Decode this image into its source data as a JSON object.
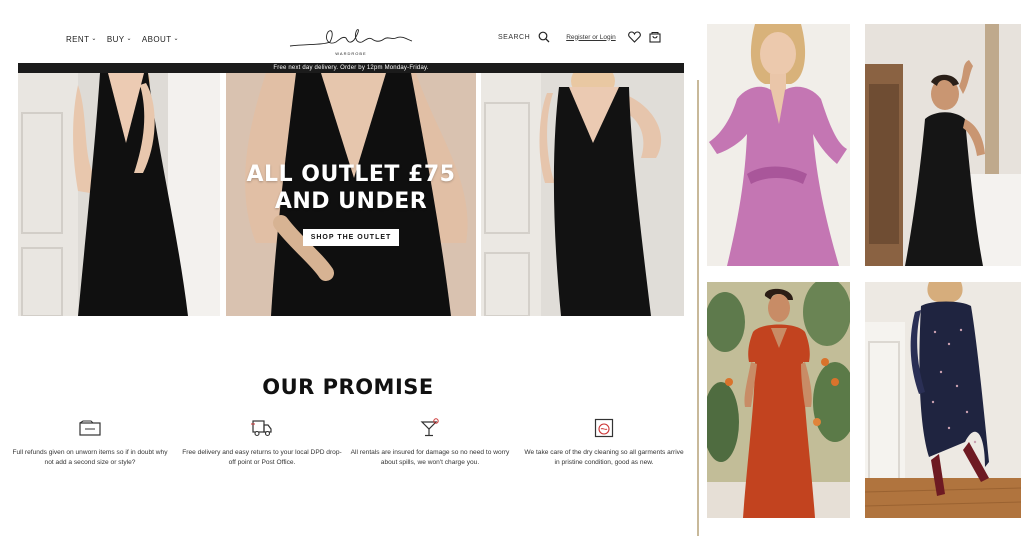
{
  "header": {
    "nav": [
      {
        "label": "RENT"
      },
      {
        "label": "BUY"
      },
      {
        "label": "ABOUT"
      }
    ],
    "logo_script": "Endless",
    "logo_sub": "WARDROBE",
    "search_label": "SEARCH",
    "login_label": "Register or Login"
  },
  "announcement": "Free next day delivery. Order by 12pm Monday-Friday.",
  "hero": {
    "title_line1": "ALL OUTLET £75",
    "title_line2": "AND UNDER",
    "cta": "SHOP THE OUTLET"
  },
  "promise": {
    "title": "OUR PROMISE",
    "items": [
      {
        "icon": "wardrobe-icon",
        "text": "Full refunds given on unworn items so if in doubt why not add a second size or style?"
      },
      {
        "icon": "delivery-truck-icon",
        "text": "Free delivery and easy returns to your local DPD drop-off point or Post Office."
      },
      {
        "icon": "cocktail-glass-icon",
        "text": "All rentals are insured for damage so no need to worry about spills, we won't charge you."
      },
      {
        "icon": "washing-machine-icon",
        "text": "We take care of the dry cleaning so all garments arrive in pristine condition, good as new."
      }
    ]
  },
  "colors": {
    "announcement_bg": "#1b1b1b",
    "divider": "#c8b99a",
    "pink_dress": "#c476b3",
    "red_dress": "#c2431f",
    "navy_dress": "#1f2440",
    "black_dress": "#151515"
  }
}
